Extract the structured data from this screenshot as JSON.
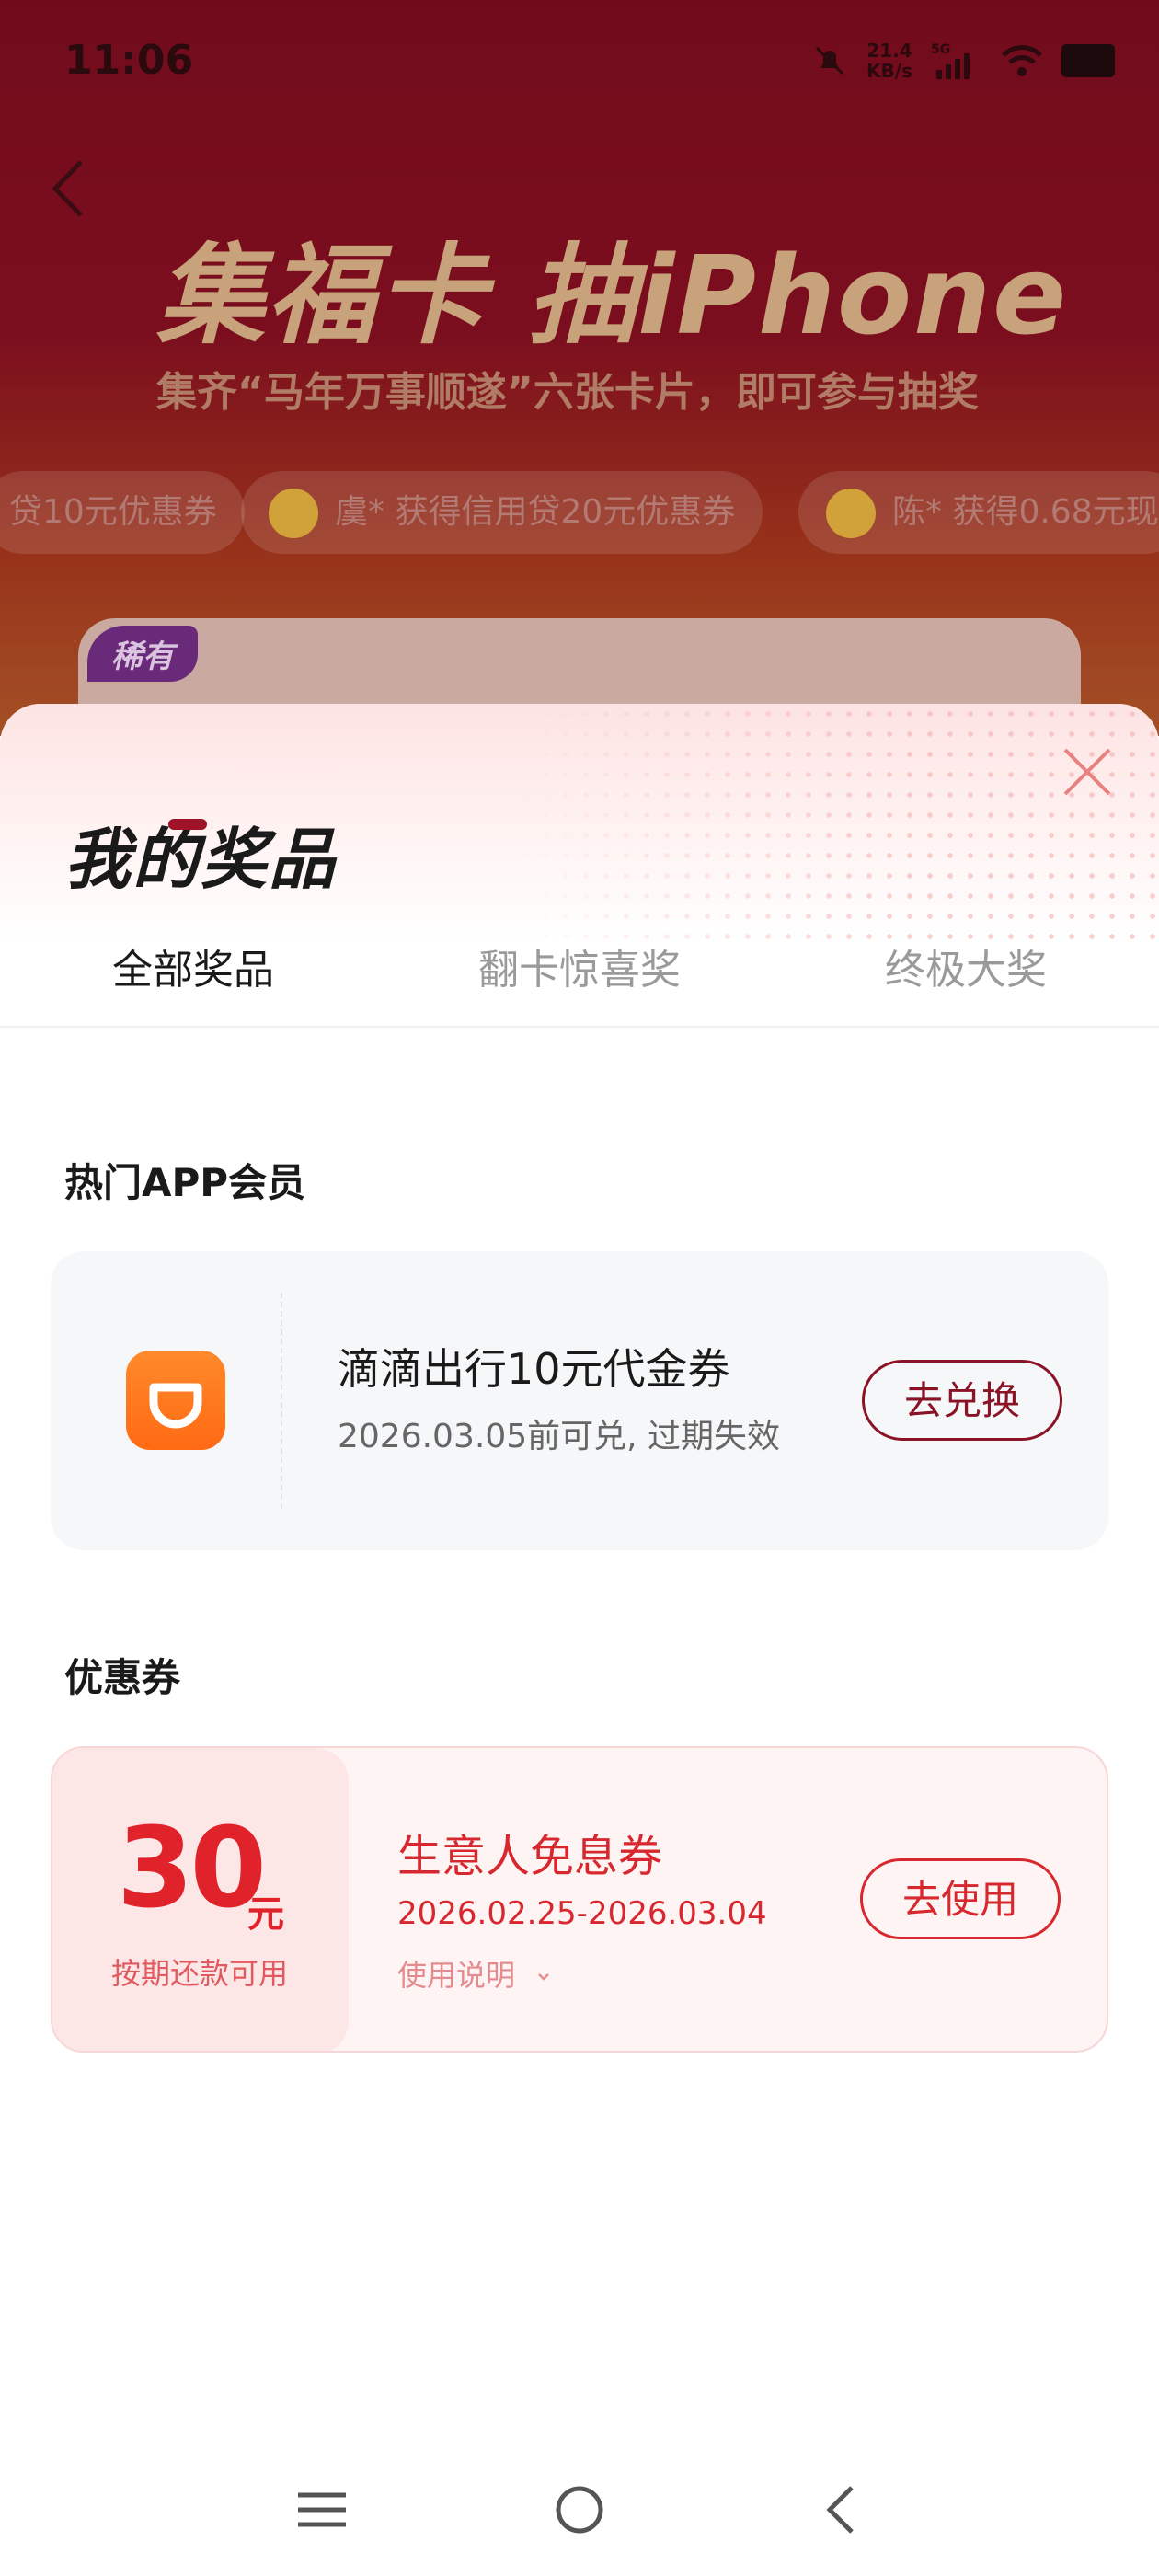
{
  "status_bar": {
    "time": "11:06",
    "net_speed": "21.4",
    "net_unit": "KB/s",
    "network": "5G"
  },
  "background": {
    "headline": "集福卡 抽iPhone",
    "subline": "集齐“马年万事顺遂”六张卡片，即可参与抽奖",
    "ticker": [
      "贷10元优惠券",
      "虞* 获得信用贷20元优惠券",
      "陈* 获得0.68元现"
    ],
    "rare_badge": "稀有"
  },
  "sheet": {
    "title": "我的奖品",
    "tabs": [
      "全部奖品",
      "翻卡惊喜奖",
      "终极大奖"
    ],
    "active_tab": 0
  },
  "membership": {
    "section_title": "热门APP会员",
    "item": {
      "name": "滴滴出行10元代金券",
      "validity": "2026.03.05前可兑, 过期失效",
      "button": "去兑换"
    }
  },
  "coupons": {
    "section_title": "优惠券",
    "item": {
      "amount": "30",
      "unit": "元",
      "condition": "按期还款可用",
      "name": "生意人免息券",
      "date_range": "2026.02.25-2026.03.04",
      "help": "使用说明",
      "button": "去使用"
    }
  },
  "colors": {
    "brand": "#8a1426",
    "coupon_red": "#e0222b",
    "didi_orange": "#ff7417"
  }
}
